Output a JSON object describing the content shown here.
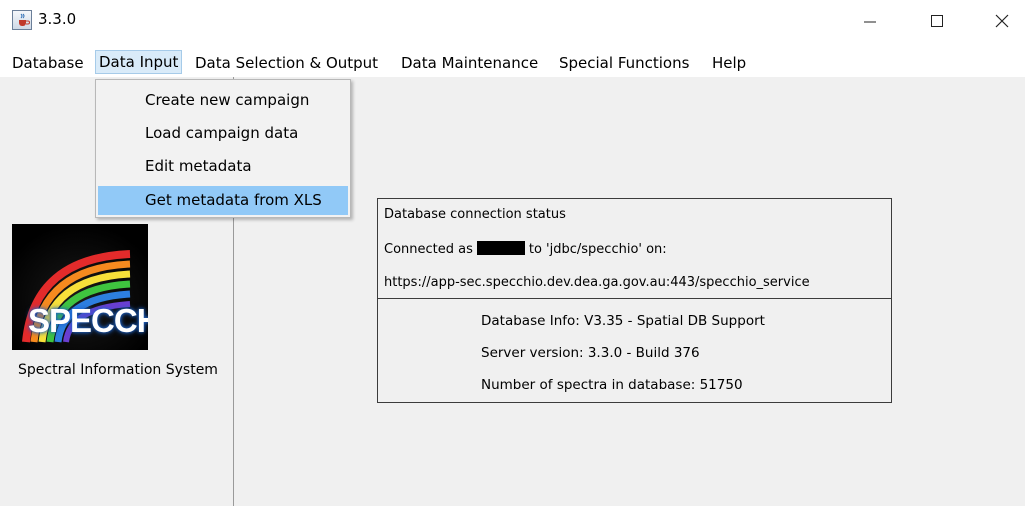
{
  "window": {
    "title": "3.3.0",
    "app_icon": "java-cup-icon",
    "controls": {
      "minimize": "minimize-icon",
      "maximize": "maximize-icon",
      "close": "close-icon"
    }
  },
  "menubar": {
    "items": [
      "Database",
      "Data Input",
      "Data Selection & Output",
      "Data Maintenance",
      "Special Functions",
      "Help"
    ],
    "active": "Data Input"
  },
  "dropdown": {
    "items": [
      "Create new campaign",
      "Load campaign data",
      "Edit metadata",
      "Get metadata from XLS"
    ],
    "highlighted": "Get metadata from XLS"
  },
  "logo": {
    "text": "SPECCHIO",
    "caption": "Spectral Information System"
  },
  "status": {
    "heading": "Database connection status",
    "connected_prefix": "Connected as",
    "connected_suffix": "to 'jdbc/specchio' on:",
    "url": "https://app-sec.specchio.dev.dea.ga.gov.au:443/specchio_service",
    "db_info": "Database Info: V3.35 - Spatial DB Support",
    "server_version": "Server version: 3.3.0 - Build 376",
    "spectra_count": "Number of spectra in database: 51750"
  }
}
